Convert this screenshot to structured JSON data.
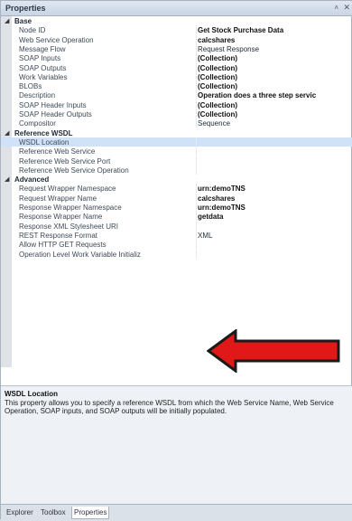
{
  "panel": {
    "title": "Properties",
    "pin_icon": "pin-icon",
    "close_icon": "close-icon"
  },
  "categories": [
    {
      "label": "Base",
      "rows": [
        {
          "name": "Node ID",
          "value": "Get Stock Purchase Data",
          "bold": true
        },
        {
          "name": "Web Service Operation",
          "value": "calcshares",
          "bold": true
        },
        {
          "name": "Message Flow",
          "value": "Request Response",
          "bold": false
        },
        {
          "name": "SOAP Inputs",
          "value": "(Collection)",
          "bold": true
        },
        {
          "name": "SOAP Outputs",
          "value": "(Collection)",
          "bold": true
        },
        {
          "name": "Work Variables",
          "value": "(Collection)",
          "bold": true
        },
        {
          "name": "BLOBs",
          "value": "(Collection)",
          "bold": true
        },
        {
          "name": "Description",
          "value": "Operation does a three step servic",
          "bold": true
        },
        {
          "name": "SOAP Header Inputs",
          "value": "(Collection)",
          "bold": true
        },
        {
          "name": "SOAP Header Outputs",
          "value": "(Collection)",
          "bold": true
        },
        {
          "name": "Compositor",
          "value": "Sequence",
          "bold": false
        }
      ]
    },
    {
      "label": "Reference WSDL",
      "rows": [
        {
          "name": "WSDL Location",
          "value": "",
          "bold": false
        },
        {
          "name": "Reference Web Service",
          "value": "",
          "bold": false
        },
        {
          "name": "Reference Web Service Port",
          "value": "",
          "bold": false
        },
        {
          "name": "Reference Web Service Operation",
          "value": "",
          "bold": false
        }
      ]
    },
    {
      "label": "Advanced",
      "rows": [
        {
          "name": "Request Wrapper Namespace",
          "value": "urn:demoTNS",
          "bold": true
        },
        {
          "name": "Request Wrapper Name",
          "value": "calcshares",
          "bold": true
        },
        {
          "name": "Response Wrapper Namespace",
          "value": "urn:demoTNS",
          "bold": true
        },
        {
          "name": "Response Wrapper Name",
          "value": "getdata",
          "bold": true
        },
        {
          "name": "Response XML Stylesheet URI",
          "value": "",
          "bold": false
        },
        {
          "name": "REST Response Format",
          "value": "XML",
          "bold": false
        },
        {
          "name": "Allow HTTP GET Requests",
          "value": "",
          "bold": false
        },
        {
          "name": "Operation Level Work Variable Initializ",
          "value": "",
          "bold": false
        }
      ]
    }
  ],
  "description": {
    "title": "WSDL Location",
    "text": "This property allows you to specify a reference WSDL from which the Web Service Name, Web Service Operation, SOAP inputs, and SOAP outputs will be initially populated."
  },
  "tabs": [
    "Explorer",
    "Toolbox",
    "Properties"
  ],
  "active_tab": "Properties",
  "colors": {
    "arrow": "#e01818",
    "arrow_outline": "#1a1a1a",
    "selected_row": "#cfe2f7"
  }
}
